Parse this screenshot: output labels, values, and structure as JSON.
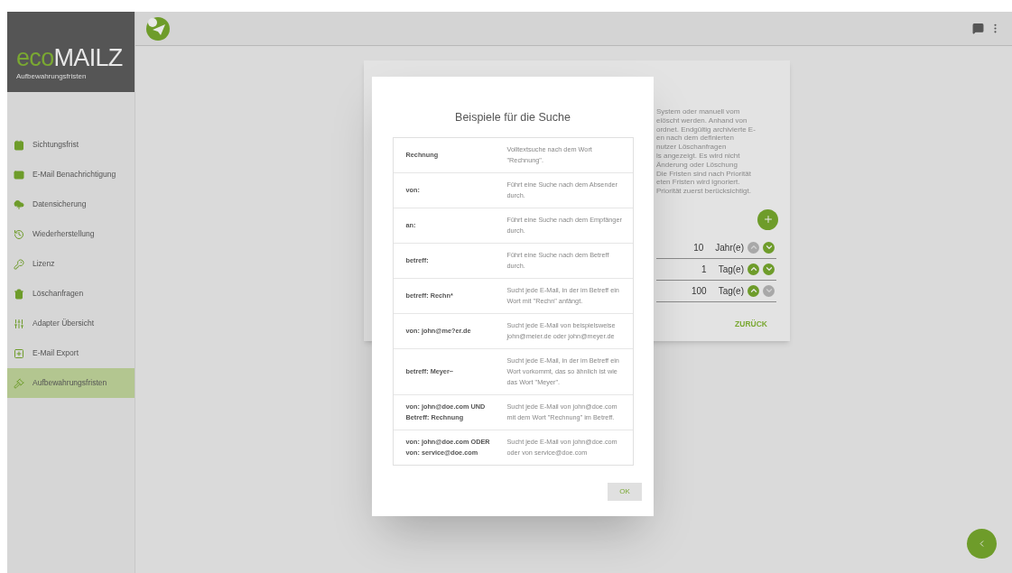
{
  "sidebar": {
    "logo": {
      "prefix": "eco",
      "name": "MAILZ"
    },
    "subtitle": "Aufbewahrungsfristen",
    "items": [
      {
        "label": "Sichtungsfrist",
        "selected": false
      },
      {
        "label": "E-Mail Benachrichtigung",
        "selected": false
      },
      {
        "label": "Datensicherung",
        "selected": false
      },
      {
        "label": "Wiederherstellung",
        "selected": false
      },
      {
        "label": "Lizenz",
        "selected": false
      },
      {
        "label": "Löschanfragen",
        "selected": false
      },
      {
        "label": "Adapter Übersicht",
        "selected": false
      },
      {
        "label": "E-Mail Export",
        "selected": false
      },
      {
        "label": "Aufbewahrungsfristen",
        "selected": true
      }
    ]
  },
  "background_card": {
    "text_lines": [
      "System oder manuell vom",
      "elöscht werden. Anhand von",
      "ordnet. Endgültig archivierte E-",
      "en nach dem definierten",
      "nutzer Löschanfragen",
      "ls angezeigt. Es wird nicht",
      "Änderung oder Löschung",
      "Die Fristen sind nach Priorität",
      "eten Fristen wird ignoriert.",
      "Priorität zuerst berücksichtigt."
    ],
    "rows": [
      {
        "value": "10",
        "unit": "Jahr(e)",
        "up_disabled": true,
        "down_disabled": false
      },
      {
        "value": "1",
        "unit": "Tag(e)",
        "up_disabled": false,
        "down_disabled": false
      },
      {
        "value": "100",
        "unit": "Tag(e)",
        "up_disabled": false,
        "down_disabled": true
      }
    ],
    "back_button": "ZURÜCK"
  },
  "dialog": {
    "title": "Beispiele für die Suche",
    "rows": [
      {
        "query": "Rechnung",
        "description": "Volltextsuche nach dem Wort \"Rechnung\"."
      },
      {
        "query": "von:",
        "description": "Führt eine Suche nach dem Absender durch."
      },
      {
        "query": "an:",
        "description": "Führt eine Suche nach dem Empfänger durch."
      },
      {
        "query": "betreff:",
        "description": "Führt eine Suche nach dem Betreff durch."
      },
      {
        "query": "betreff: Rechn*",
        "description": "Sucht jede E-Mail, in der im Betreff ein Wort mit \"Rechn\" anfängt."
      },
      {
        "query": "von: john@me?er.de",
        "description": "Sucht jede E-Mail von beispielsweise john@meier.de oder john@meyer.de"
      },
      {
        "query": "betreff: Meyer~",
        "description": "Sucht jede E-Mail, in der im Betreff ein Wort vorkommt, das so ähnlich ist wie das Wort \"Meyer\"."
      },
      {
        "query": "von: john@doe.com UND Betreff: Rechnung",
        "description": "Sucht jede E-Mail von john@doe.com mit dem Wort \"Rechnung\" im Betreff."
      },
      {
        "query": "von: john@doe.com ODER von: service@doe.com",
        "description": "Sucht jede E-Mail von john@doe.com oder von service@doe.com"
      }
    ],
    "ok_button": "OK"
  }
}
